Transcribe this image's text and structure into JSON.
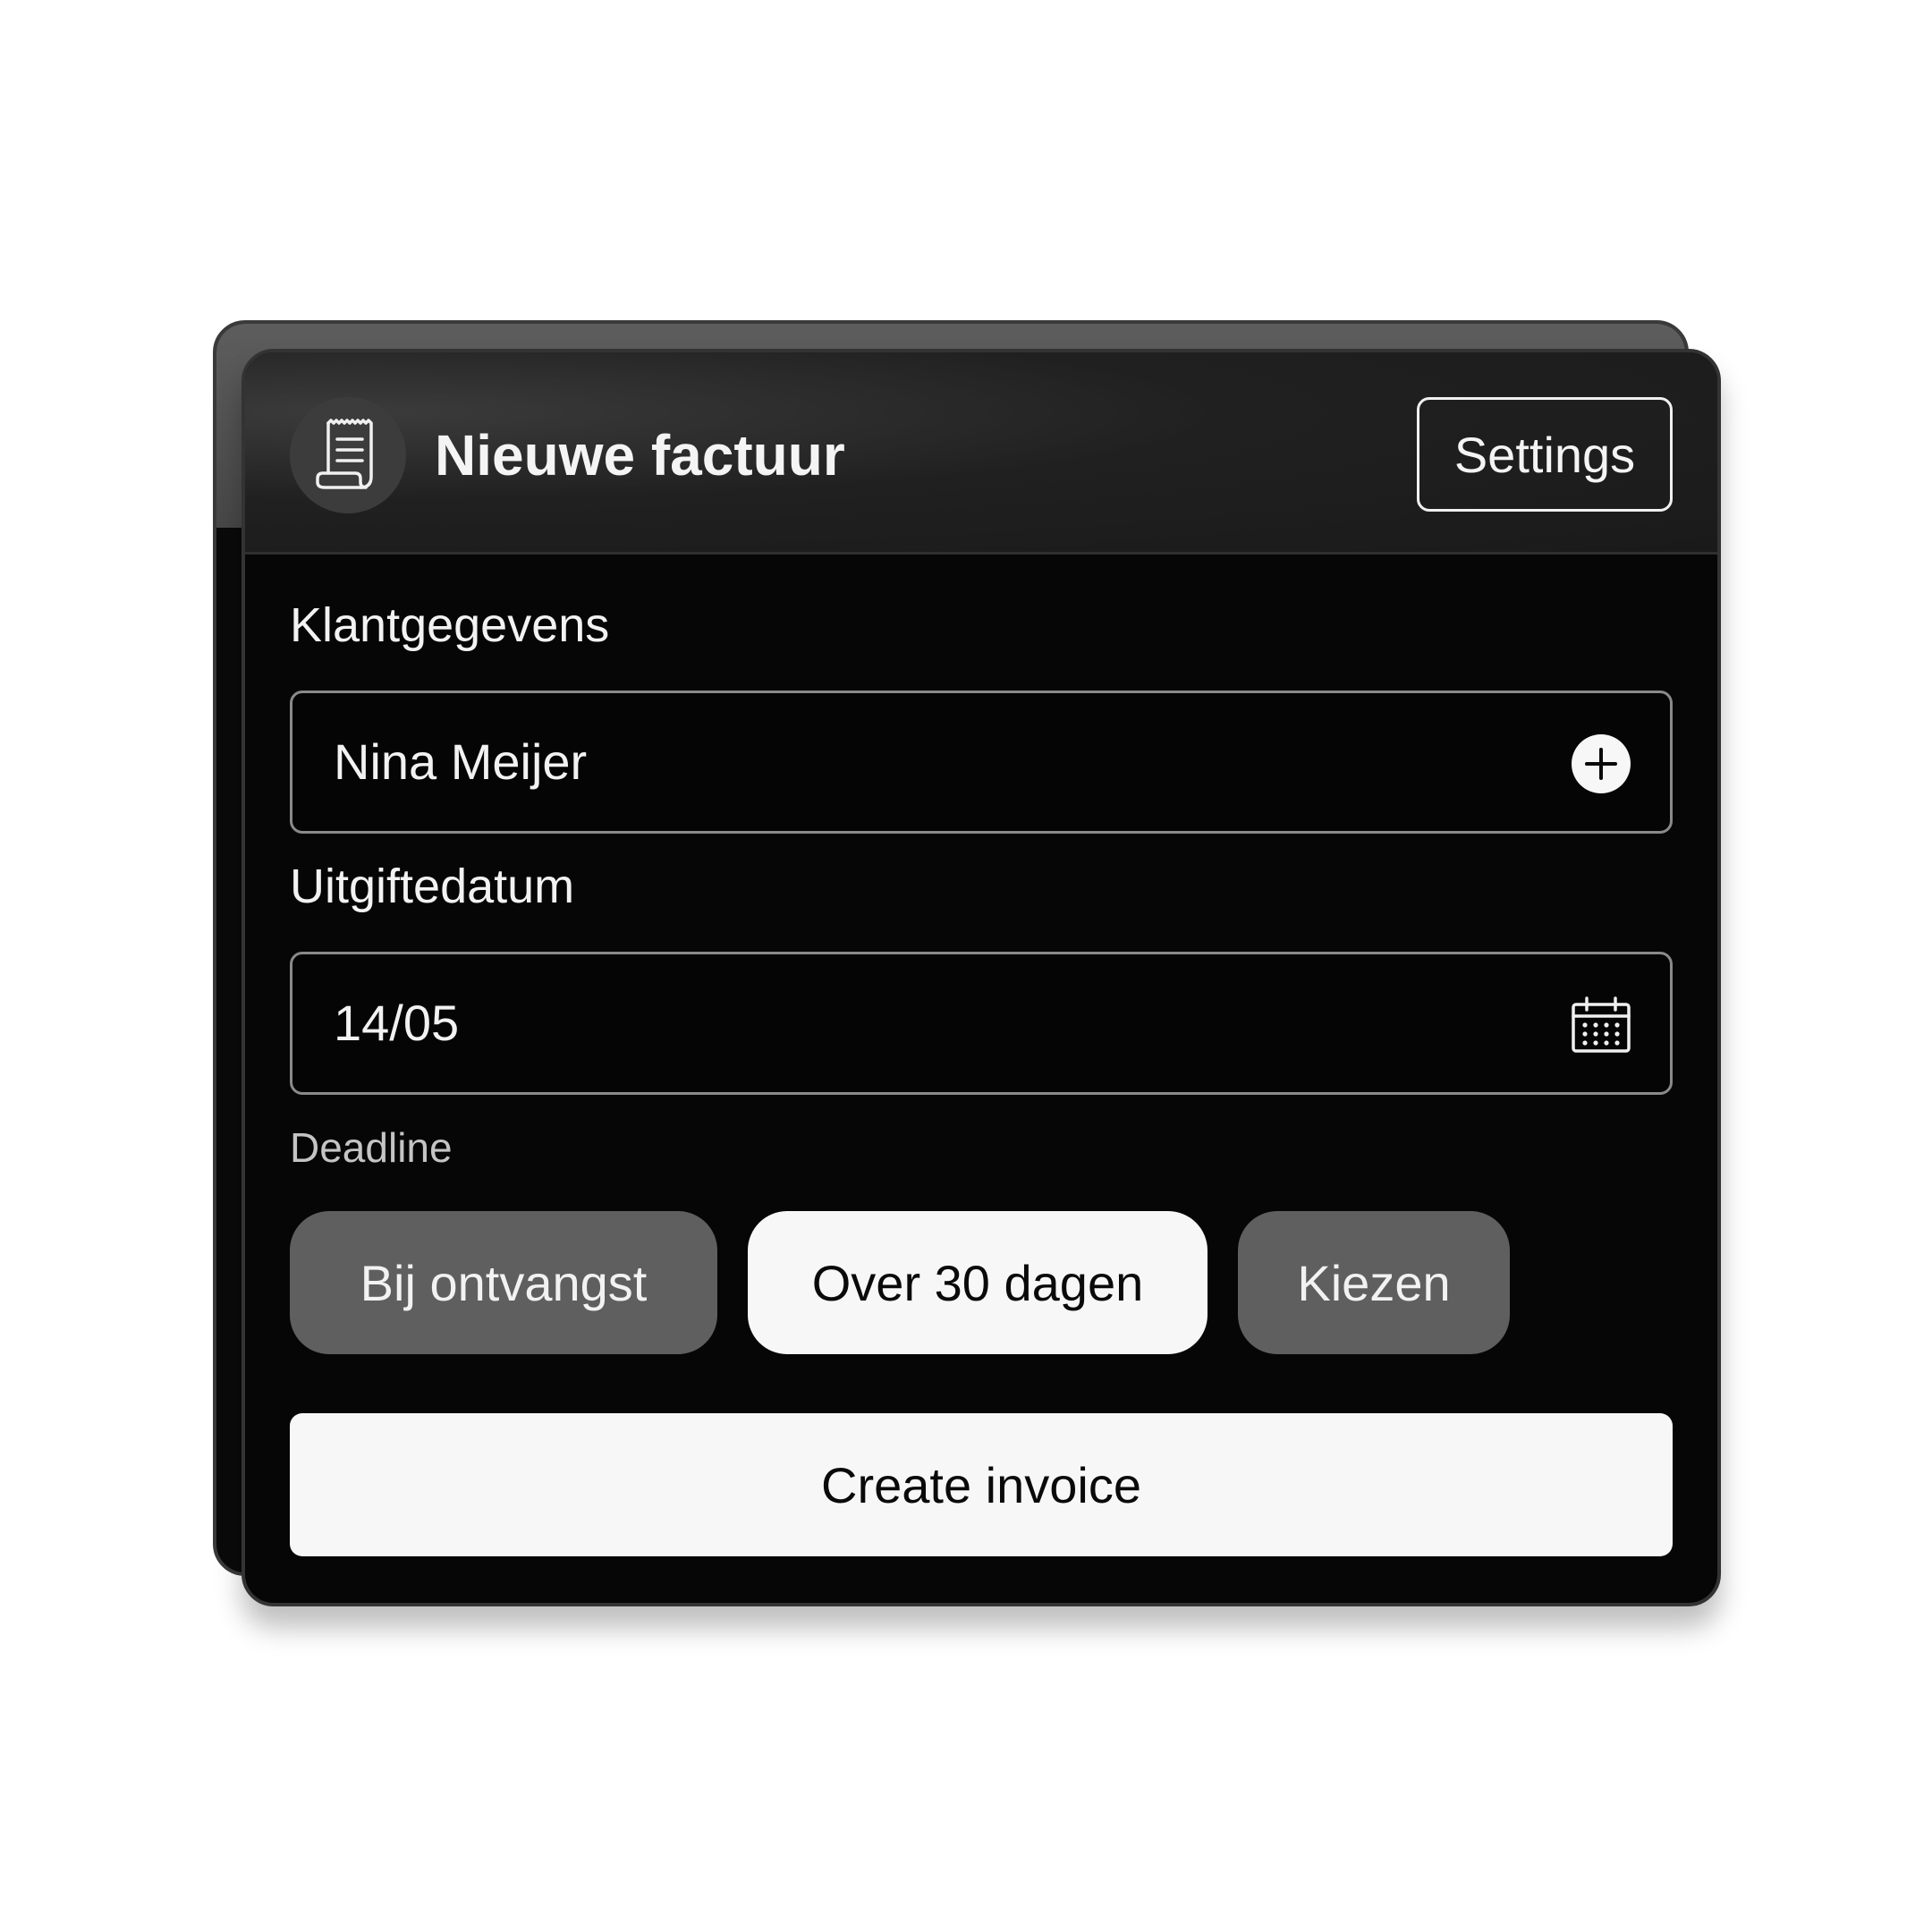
{
  "header": {
    "title": "Nieuwe factuur",
    "icon": "receipt-icon",
    "settings_label": "Settings"
  },
  "customer": {
    "label": "Klantgegevens",
    "value": "Nina Meijer",
    "icon": "add-circle-icon"
  },
  "issue_date": {
    "label": "Uitgiftedatum",
    "value": "14/05",
    "icon": "calendar-icon"
  },
  "deadline": {
    "label": "Deadline",
    "options": [
      {
        "label": "Bij ontvangst",
        "selected": false
      },
      {
        "label": "Over 30 dagen",
        "selected": true
      },
      {
        "label": "Kiezen",
        "selected": false
      }
    ]
  },
  "actions": {
    "create_label": "Create invoice"
  },
  "colors": {
    "card_background": "#060606",
    "header_background": "#1f1f1f",
    "chip_inactive": "#5f5f5f",
    "chip_active": "#f7f7f7",
    "text_light": "#f2f2f2",
    "text_dark": "#0a0a0a",
    "input_border": "#8a8a8a"
  }
}
